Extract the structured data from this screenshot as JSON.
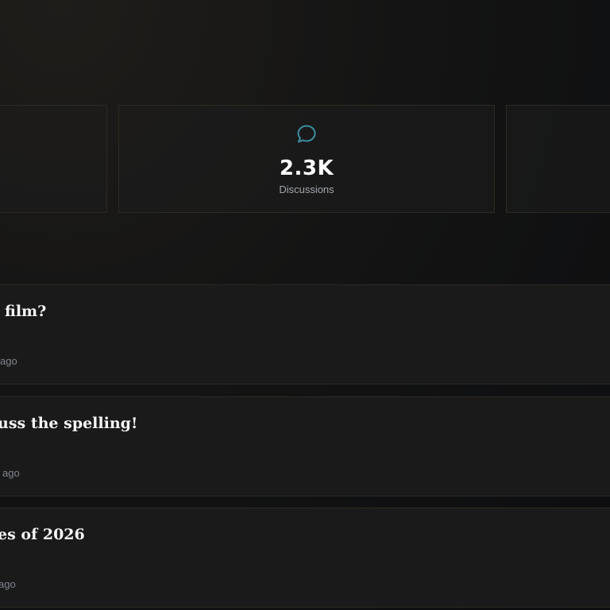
{
  "stats": {
    "center": {
      "icon": "chat-bubble-icon",
      "value": "2.3K",
      "label": "Discussions"
    }
  },
  "posts": [
    {
      "title": "film?",
      "time": "ago"
    },
    {
      "title": "uss the spelling!",
      "time": "ago"
    },
    {
      "title": "es of 2026",
      "time": "ago"
    }
  ],
  "colors": {
    "accent": "#3a8fa3",
    "border": "#2e2a22",
    "muted": "#7f858e"
  }
}
